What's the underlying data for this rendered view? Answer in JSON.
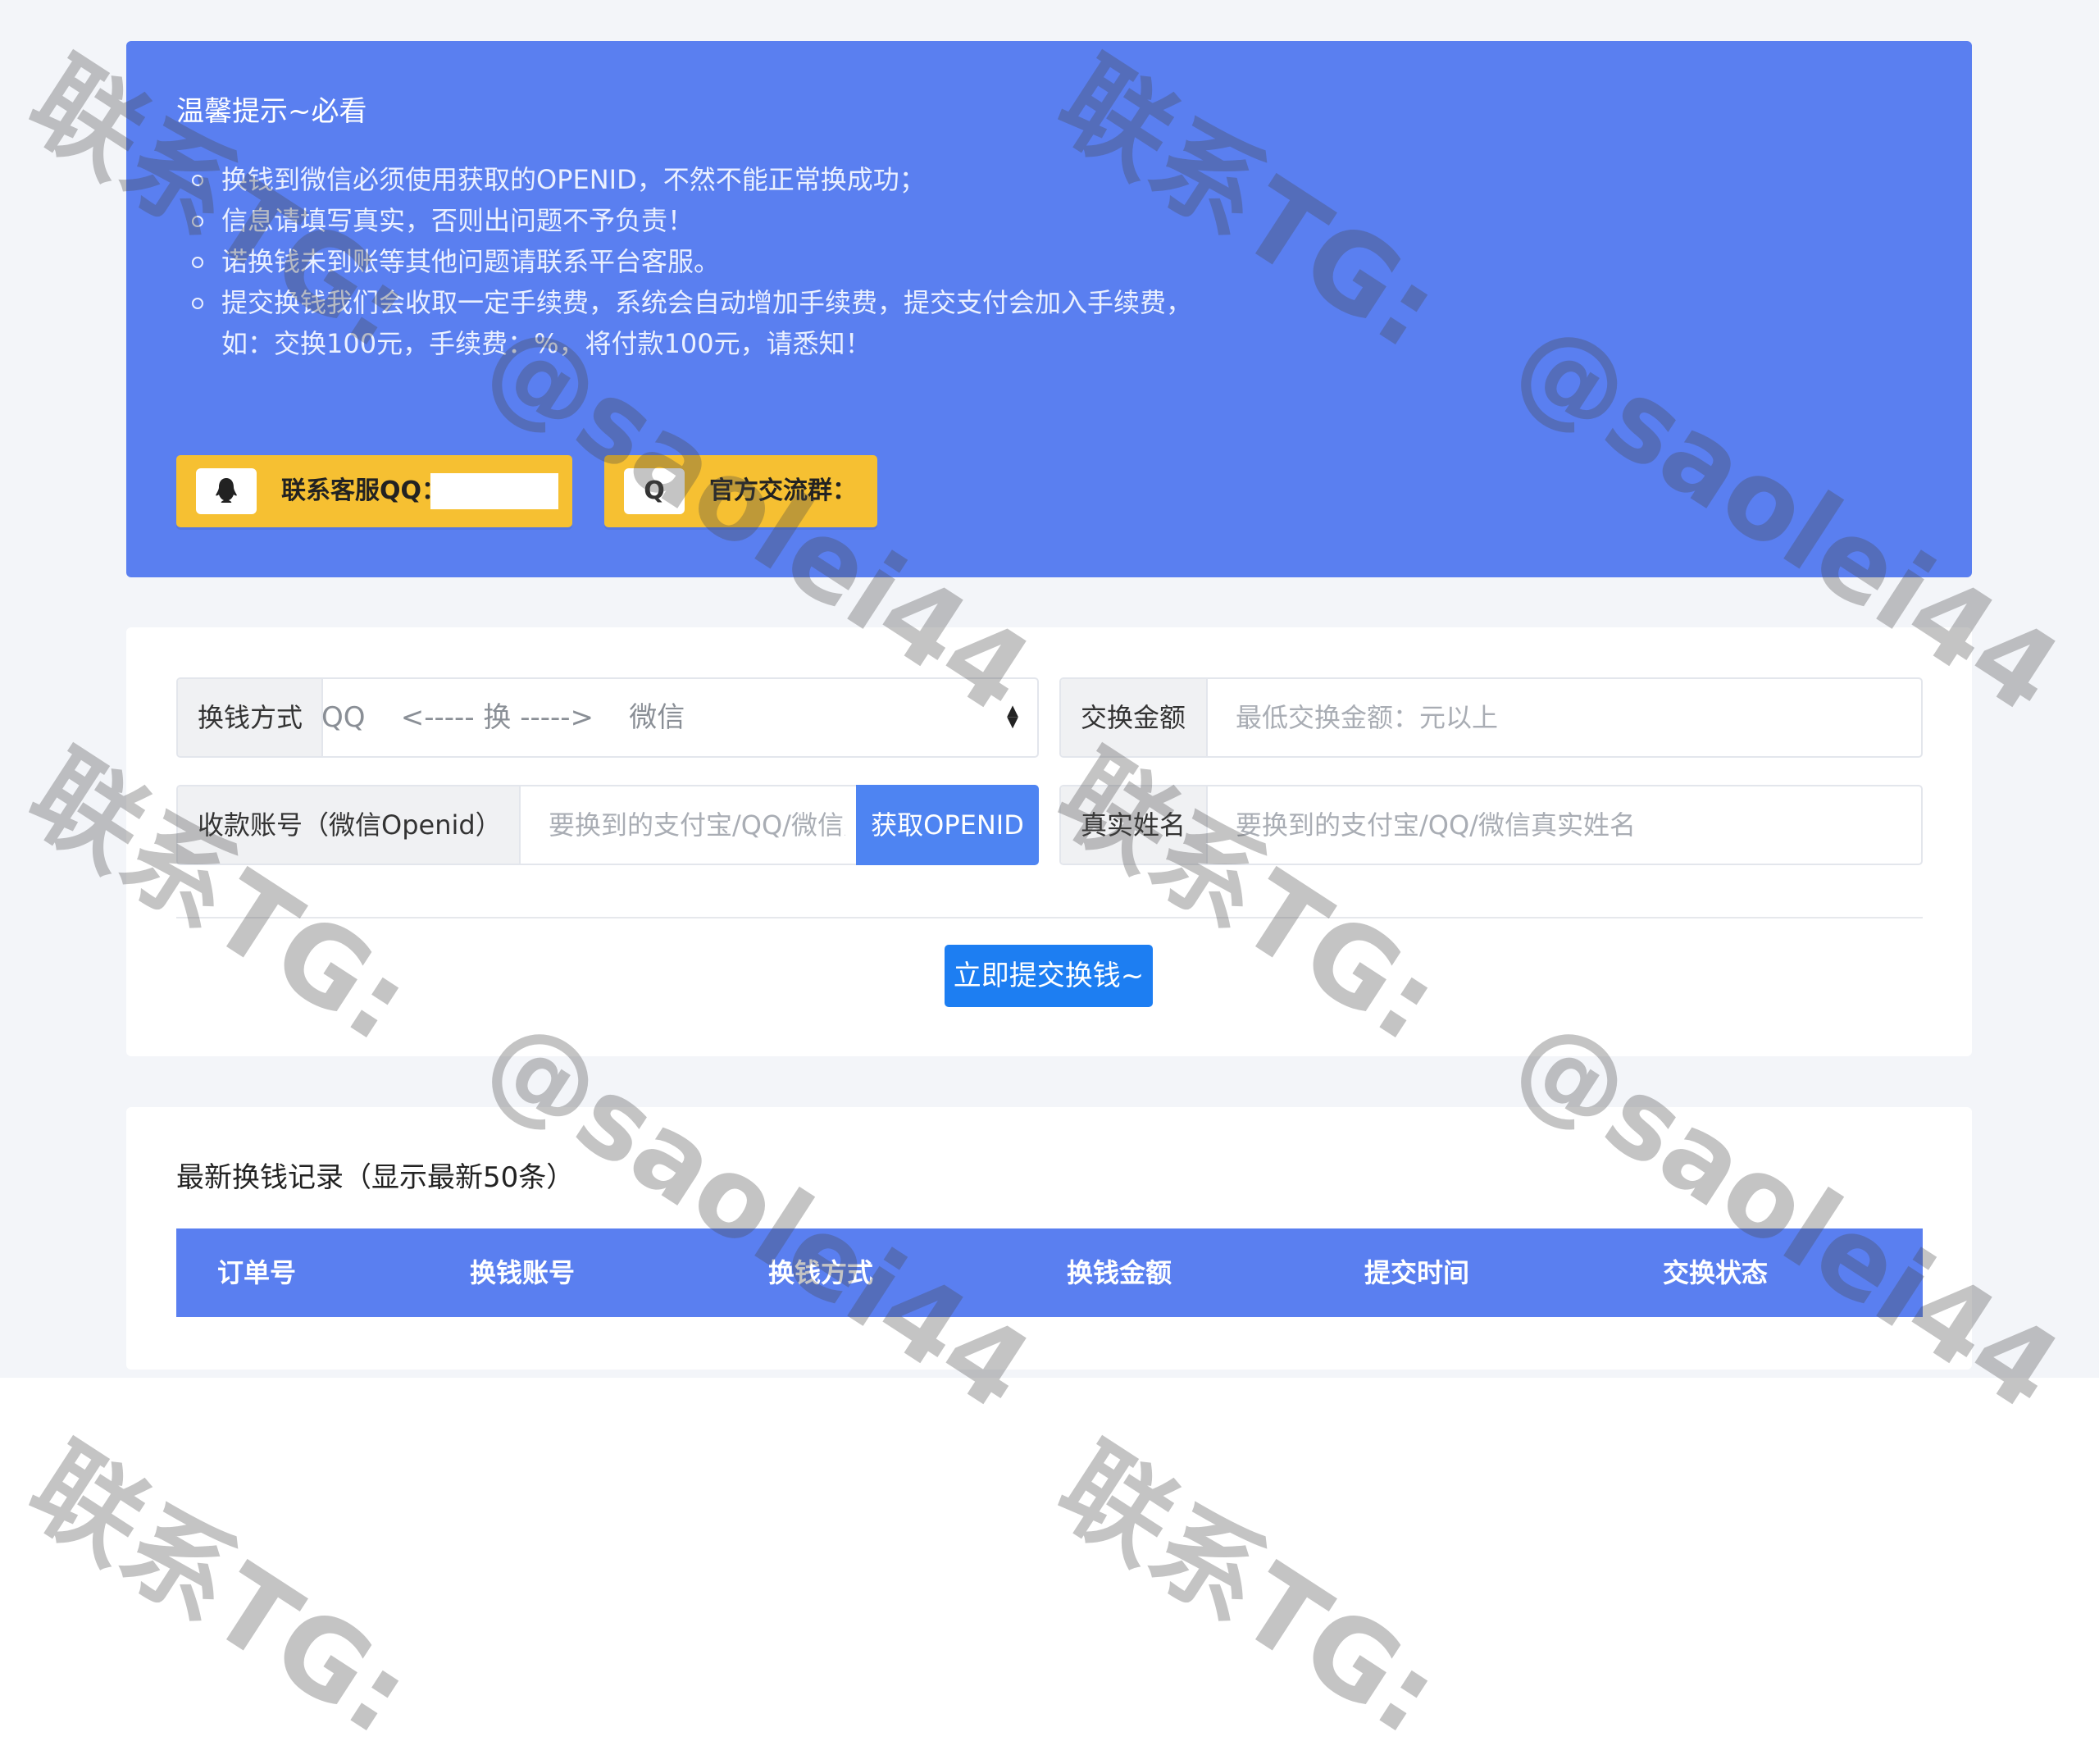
{
  "notice": {
    "title": "温馨提示~必看",
    "items": [
      "换钱到微信必须使用获取的OPENID，不然不能正常换成功；",
      "信息请填写真实，否则出问题不予负责！",
      "诺换钱未到账等其他问题请联系平台客服。",
      "提交换钱我们会收取一定手续费，系统会自动增加手续费，提交支付会加入手续费，如：交换100元，手续费：%，将付款100元，请悉知！"
    ],
    "contact_icon": "qq-penguin-icon",
    "contact_label": "联系客服QQ：",
    "group_icon_glyph": "Q",
    "group_label": "官方交流群："
  },
  "form": {
    "method_label": "换钱方式",
    "method_value": "QQ    <----- 换 ----->    微信",
    "amount_label": "交换金额",
    "amount_placeholder": "最低交换金额：元以上",
    "account_label": "收款账号（微信Openid）",
    "account_placeholder": "要换到的支付宝/QQ/微信账号",
    "get_openid_label": "获取OPENID",
    "name_label": "真实姓名",
    "name_placeholder": "要换到的支付宝/QQ/微信真实姓名",
    "submit_label": "立即提交换钱~"
  },
  "records": {
    "title": "最新换钱记录（显示最新50条）",
    "columns": [
      "订单号",
      "换钱账号",
      "换钱方式",
      "换钱金额",
      "提交时间",
      "交换状态"
    ]
  },
  "watermark": {
    "line1": "联系TG:",
    "line2": "@saolei44"
  },
  "colors": {
    "primary_blue": "#5a7ff0",
    "button_blue": "#1d7ef2",
    "yellow": "#f6c032"
  }
}
